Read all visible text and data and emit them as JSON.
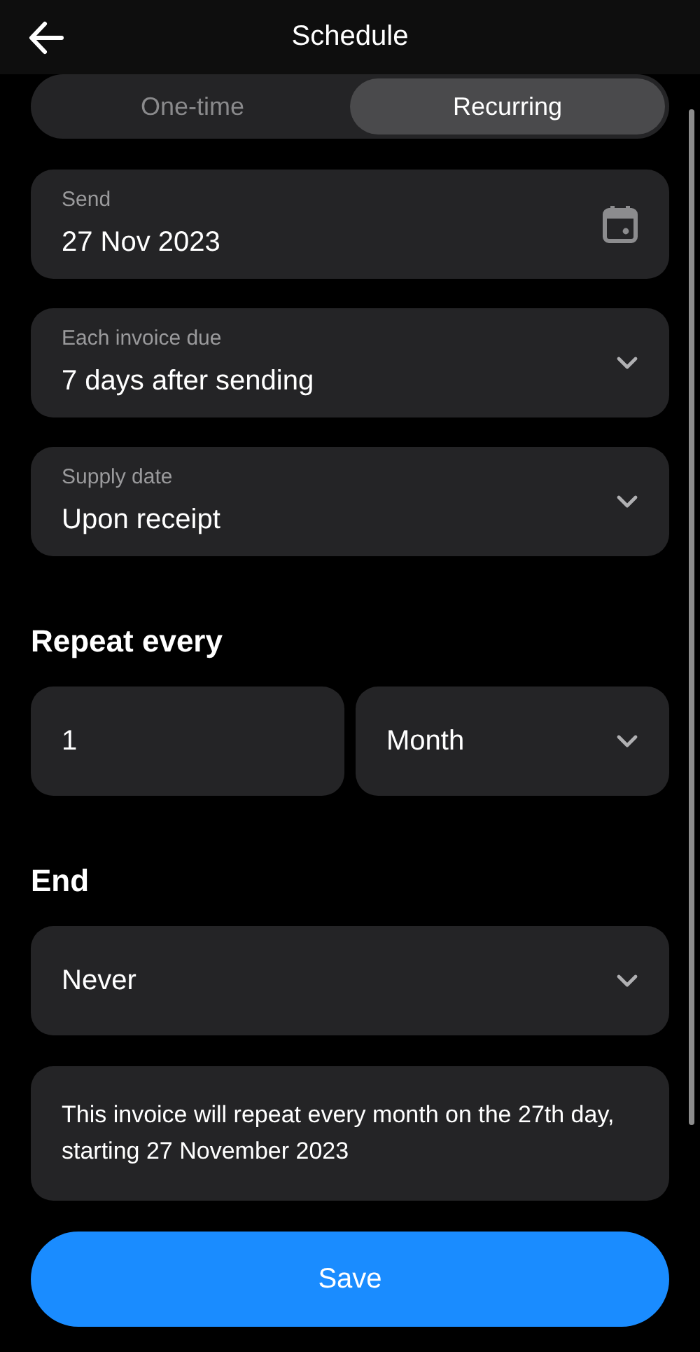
{
  "header": {
    "title": "Schedule"
  },
  "segments": [
    {
      "label": "One-time",
      "selected": false
    },
    {
      "label": "Recurring",
      "selected": true
    }
  ],
  "fields": [
    {
      "kind": "date",
      "label": "Send",
      "value": "27 Nov 2023"
    },
    {
      "kind": "select",
      "label": "Each invoice due",
      "value": "7 days after sending"
    },
    {
      "kind": "select",
      "label": "Supply date",
      "value": "Upon receipt"
    }
  ],
  "repeat": {
    "heading": "Repeat every",
    "count": "1",
    "unit": "Month"
  },
  "end": {
    "heading": "End",
    "value": "Never"
  },
  "summary": "This invoice will repeat every month on the 27th day, starting 27 November 2023",
  "save_button": "Save"
}
